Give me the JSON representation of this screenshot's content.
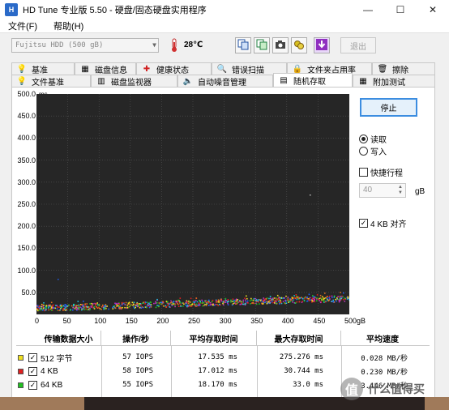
{
  "window": {
    "title": "HD Tune 专业版 5.50 - 硬盘/固态硬盘实用程序",
    "minimize": "—",
    "maximize": "☐",
    "close": "✕"
  },
  "menu": {
    "file": "文件(F)",
    "help": "帮助(H)"
  },
  "toolbar": {
    "drive": "Fujitsu HDD (500 gB)",
    "temperature": "28℃",
    "exit_label": "退出"
  },
  "tabs_row1": [
    {
      "label": "基准",
      "icon": "benchmark-icon"
    },
    {
      "label": "磁盘信息",
      "icon": "disk-info-icon"
    },
    {
      "label": "健康状态",
      "icon": "health-icon"
    },
    {
      "label": "错误扫描",
      "icon": "error-scan-icon"
    },
    {
      "label": "文件夹占用率",
      "icon": "folder-usage-icon"
    },
    {
      "label": "擦除",
      "icon": "erase-icon"
    }
  ],
  "tabs_row2": [
    {
      "label": "文件基准",
      "icon": "file-benchmark-icon"
    },
    {
      "label": "磁盘监视器",
      "icon": "disk-monitor-icon"
    },
    {
      "label": "自动噪音管理",
      "icon": "aam-icon"
    },
    {
      "label": "随机存取",
      "icon": "random-access-icon",
      "active": true
    },
    {
      "label": "附加测试",
      "icon": "extra-tests-icon"
    }
  ],
  "graph": {
    "y_unit": "ms",
    "y_ticks": [
      "500.0",
      "450.0",
      "400.0",
      "350.0",
      "300.0",
      "250.0",
      "200.0",
      "150.0",
      "100.0",
      "50.0"
    ],
    "x_ticks": [
      "0",
      "50",
      "100",
      "150",
      "200",
      "250",
      "300",
      "350",
      "400",
      "450",
      "500gB"
    ]
  },
  "controls": {
    "stop_label": "停止",
    "read_label": "读取",
    "write_label": "写入",
    "quick_run_label": "快捷行程",
    "quick_value": "40",
    "gb_label": "gB",
    "four_kb_align_label": "4 KB 对齐"
  },
  "table": {
    "headers": [
      "传输数据大小",
      "操作/秒",
      "平均存取时间",
      "最大存取时间",
      "平均速度"
    ],
    "rows": [
      {
        "color": "#f0e020",
        "size": "512 字节",
        "iops": "57 IOPS",
        "avg": "17.535 ms",
        "max": "275.276 ms",
        "speed": "0.028 MB/秒"
      },
      {
        "color": "#e02020",
        "size": "4 KB",
        "iops": "58 IOPS",
        "avg": "17.012 ms",
        "max": "30.744 ms",
        "speed": "0.230 MB/秒"
      },
      {
        "color": "#20c020",
        "size": "64 KB",
        "iops": "55 IOPS",
        "avg": "18.170 ms",
        "max": "33.0 ms",
        "speed": "3.446 MB/秒"
      }
    ]
  },
  "watermark": {
    "text": "什么值得买",
    "glyph": "值"
  }
}
